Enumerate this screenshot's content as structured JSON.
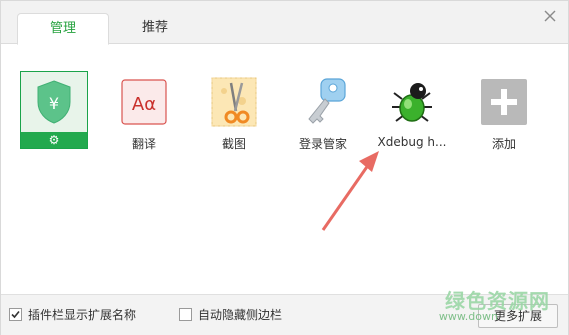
{
  "tabs": [
    {
      "label": "管理",
      "active": true
    },
    {
      "label": "推荐",
      "active": false
    }
  ],
  "extensions": [
    {
      "id": "security",
      "label": "",
      "icon": "shield-yuan-icon"
    },
    {
      "id": "translate",
      "label": "翻译",
      "icon": "translate-icon"
    },
    {
      "id": "screenshot",
      "label": "截图",
      "icon": "scissors-icon"
    },
    {
      "id": "login",
      "label": "登录管家",
      "icon": "key-icon"
    },
    {
      "id": "xdebug",
      "label": "Xdebug h...",
      "icon": "bug-icon"
    },
    {
      "id": "add",
      "label": "添加",
      "icon": "plus-icon"
    }
  ],
  "security": {
    "symbol": "¥",
    "gear": "⚙"
  },
  "translate_icon_text": "Aα",
  "bottom": {
    "show_names_label": "插件栏显示扩展名称",
    "show_names_checked": true,
    "autohide_label": "自动隐藏侧边栏",
    "autohide_checked": false,
    "more_button": "更多扩展"
  },
  "watermark": {
    "text": "绿色资源网",
    "sub": "www.down"
  },
  "colors": {
    "accent": "#26a23f",
    "arrow": "#e86b63"
  }
}
